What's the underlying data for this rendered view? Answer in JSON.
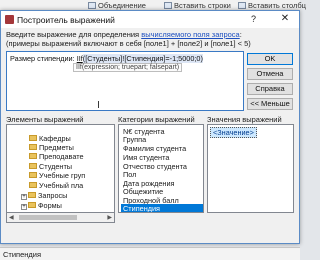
{
  "background_app": {
    "ribbon": {
      "item1": "Объединение",
      "item2": "Вставить строки",
      "item3": "Вставить столбц"
    },
    "status_field": "Стипендия"
  },
  "dialog": {
    "title": "Построитель выражений",
    "help_glyph": "?",
    "close_glyph": "✕",
    "hint_line1_prefix": "Введите выражение для определения ",
    "hint_line1_link": "вычисляемого поля запроса",
    "hint_line1_suffix": ":",
    "hint_line2": "(примеры выражений включают в себя [поле1] + [поле2] и [поле1] < 5)",
    "expression": {
      "prefix": "Размер стипендии: ",
      "function": "IIf",
      "body": "([Студенты]![Стипендия]=-1;5000;0)",
      "tooltip": "IIf(expression; truepart; falsepart)"
    },
    "buttons": {
      "ok": "OK",
      "cancel": "Отмена",
      "help": "Справка",
      "less": "<< Меньше"
    },
    "panels": {
      "elements_label": "Элементы выражений",
      "categories_label": "Категории выражений",
      "values_label": "Значения выражений"
    },
    "elements_tree": [
      {
        "label": "Кафедры"
      },
      {
        "label": "Предметы"
      },
      {
        "label": "Преподавате"
      },
      {
        "label": "Студенты"
      },
      {
        "label": "Учебные груп"
      },
      {
        "label": "Учебный пла"
      },
      {
        "label": "Запросы"
      },
      {
        "label": "Формы"
      }
    ],
    "categories": [
      "N€ студента",
      "Группа",
      "Фамилия студента",
      "Имя студента",
      "Отчество студента",
      "Пол",
      "Дата рождения",
      "Общежитие",
      "Проходной балл",
      "Стипендия"
    ],
    "selected_category": "Стипендия",
    "values": [
      "<Значение>"
    ]
  }
}
